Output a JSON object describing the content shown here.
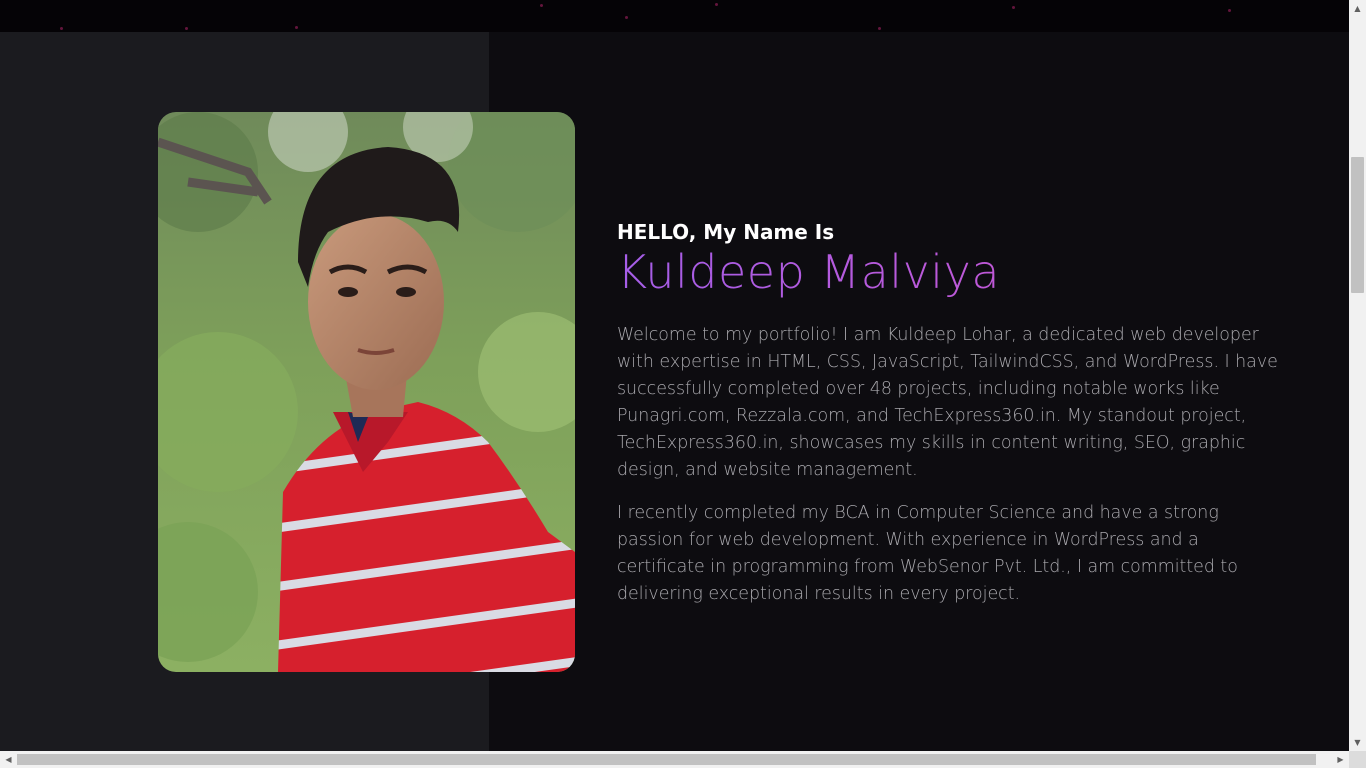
{
  "about": {
    "greeting": "HELLO, My Name Is",
    "name": "Kuldeep Malviya",
    "paragraphs": [
      "Welcome to my portfolio! I am Kuldeep Lohar, a dedicated web developer with expertise in HTML, CSS, JavaScript, TailwindCSS, and WordPress. I have successfully completed over 48 projects, including notable works like Punagri.com, Rezzala.com, and TechExpress360.in. My standout project, TechExpress360.in, showcases my skills in content writing, SEO, graphic design, and website management.",
      "I recently completed my BCA in Computer Science and have a strong passion for web development. With experience in WordPress and a certificate in programming from WebSenor Pvt. Ltd., I am committed to delivering exceptional results in every project."
    ]
  },
  "colors": {
    "name_gradient_start": "#a55ee8",
    "name_gradient_end": "#c559c9",
    "left_panel": "#1b1b1f",
    "right_panel": "#0d0c10",
    "body_text": "#a9a8ad"
  },
  "scrollbars": {
    "vertical_up_icon": "triangle-up",
    "vertical_down_icon": "triangle-down",
    "horizontal_left_icon": "triangle-left",
    "horizontal_right_icon": "triangle-right"
  }
}
